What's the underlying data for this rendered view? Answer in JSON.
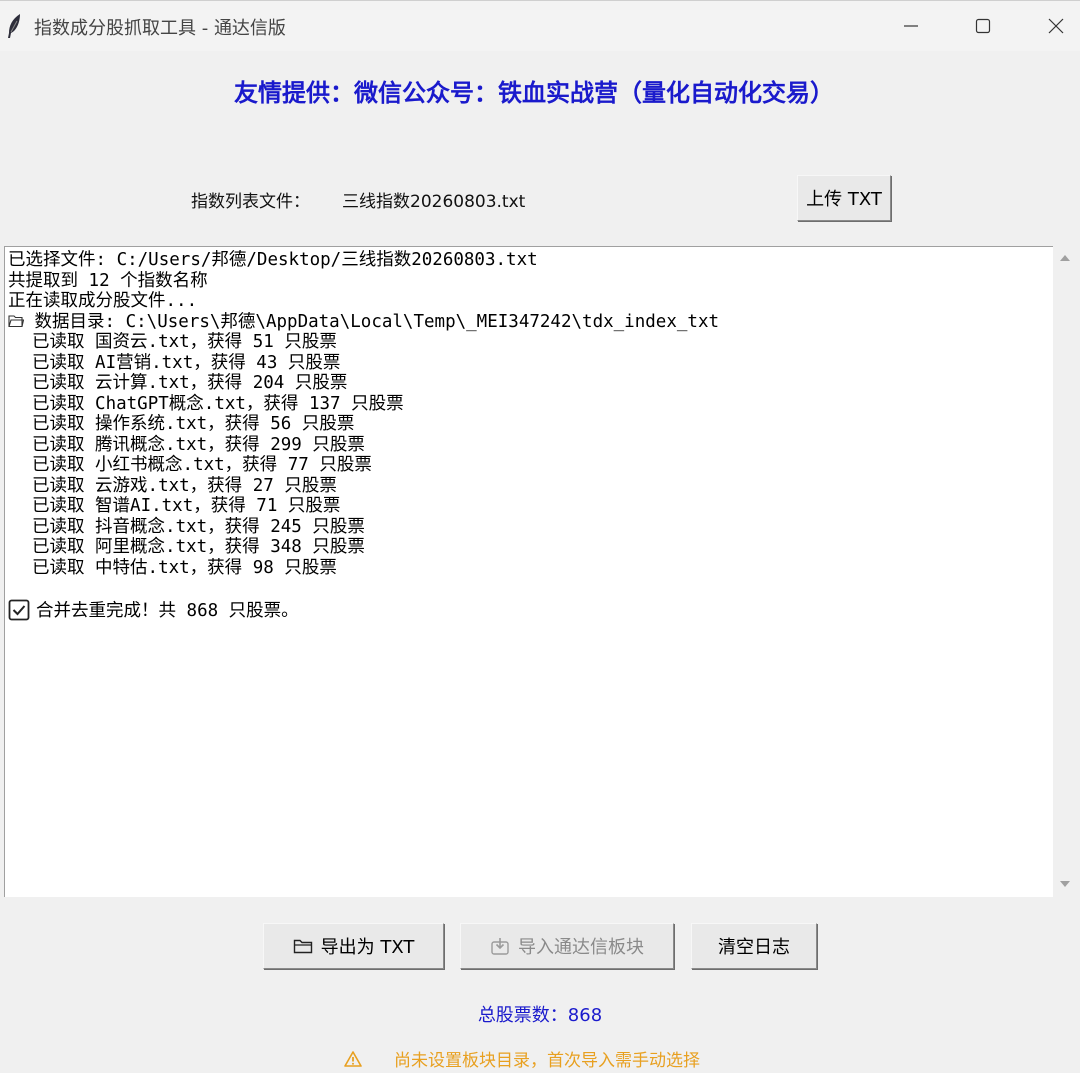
{
  "window": {
    "title": "指数成分股抓取工具 - 通达信版",
    "icons": {
      "app": "feather-icon",
      "minimize": "minimize-icon",
      "maximize": "maximize-icon",
      "close": "close-icon"
    }
  },
  "banner": "友情提供：微信公众号：铁血实战营（量化自动化交易）",
  "file_row": {
    "label": "指数列表文件：",
    "filename": "三线指数20260803.txt",
    "upload_button": "上传 TXT"
  },
  "log": {
    "lines": [
      {
        "text": "已选择文件: C:/Users/邦德/Desktop/三线指数20260803.txt",
        "indent": false,
        "icon": ""
      },
      {
        "text": "共提取到 12 个指数名称",
        "indent": false,
        "icon": ""
      },
      {
        "text": "正在读取成分股文件...",
        "indent": false,
        "icon": ""
      },
      {
        "text": " 数据目录: C:\\Users\\邦德\\AppData\\Local\\Temp\\_MEI347242\\tdx_index_txt",
        "indent": false,
        "icon": "folder-icon"
      },
      {
        "text": "已读取 国资云.txt，获得 51 只股票",
        "indent": true,
        "icon": ""
      },
      {
        "text": "已读取 AI营销.txt，获得 43 只股票",
        "indent": true,
        "icon": ""
      },
      {
        "text": "已读取 云计算.txt，获得 204 只股票",
        "indent": true,
        "icon": ""
      },
      {
        "text": "已读取 ChatGPT概念.txt，获得 137 只股票",
        "indent": true,
        "icon": ""
      },
      {
        "text": "已读取 操作系统.txt，获得 56 只股票",
        "indent": true,
        "icon": ""
      },
      {
        "text": "已读取 腾讯概念.txt，获得 299 只股票",
        "indent": true,
        "icon": ""
      },
      {
        "text": "已读取 小红书概念.txt，获得 77 只股票",
        "indent": true,
        "icon": ""
      },
      {
        "text": "已读取 云游戏.txt，获得 27 只股票",
        "indent": true,
        "icon": ""
      },
      {
        "text": "已读取 智谱AI.txt，获得 71 只股票",
        "indent": true,
        "icon": ""
      },
      {
        "text": "已读取 抖音概念.txt，获得 245 只股票",
        "indent": true,
        "icon": ""
      },
      {
        "text": "已读取 阿里概念.txt，获得 348 只股票",
        "indent": true,
        "icon": ""
      },
      {
        "text": "已读取 中特估.txt，获得 98 只股票",
        "indent": true,
        "icon": ""
      },
      {
        "text": "",
        "indent": false,
        "icon": ""
      },
      {
        "text": "合并去重完成！共 868 只股票。",
        "indent": false,
        "icon": "check-box-icon"
      }
    ]
  },
  "buttons": {
    "export": {
      "label": "导出为 TXT",
      "icon": "folder-icon"
    },
    "import": {
      "label": "导入通达信板块",
      "icon": "import-icon",
      "disabled": true
    },
    "clear": {
      "label": "清空日志"
    }
  },
  "status": {
    "total": "总股票数：868",
    "warning": "尚未设置板块目录，首次导入需手动选择",
    "warning_icon": "warning-icon"
  },
  "colors": {
    "accent_blue": "#1a1acc",
    "warning_orange": "#e8a020",
    "window_bg": "#f0f0f0"
  }
}
